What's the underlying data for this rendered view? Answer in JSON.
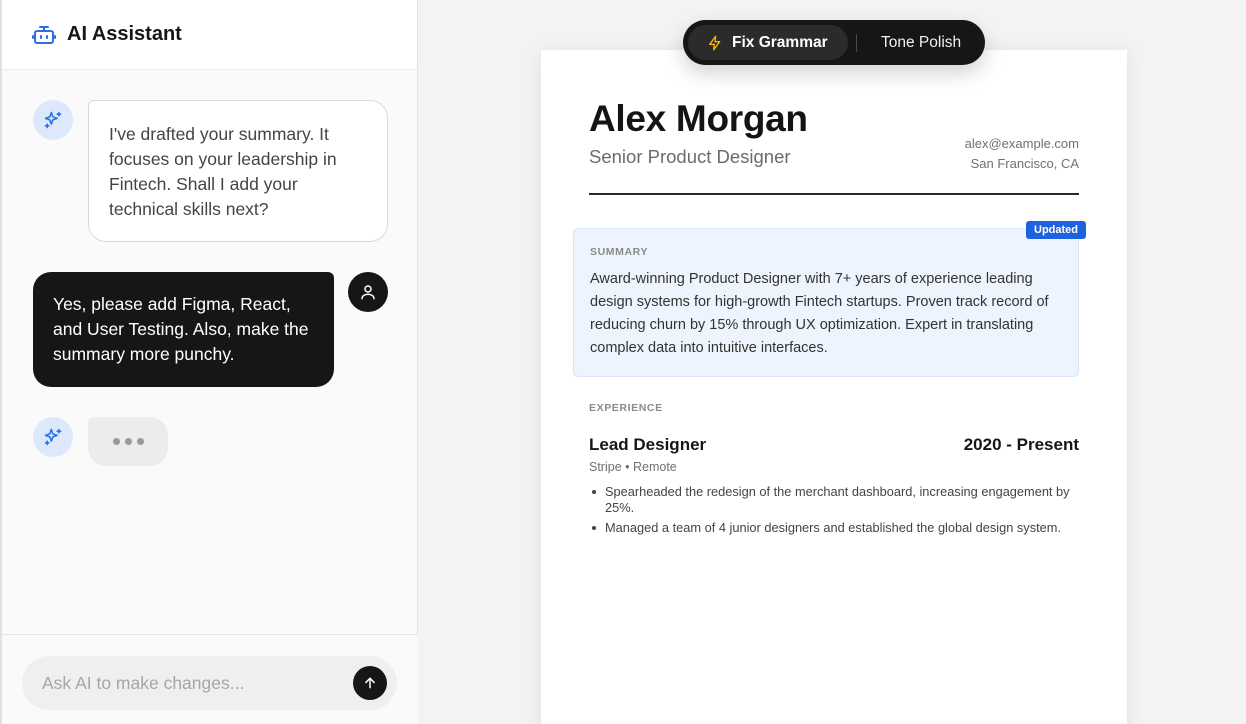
{
  "sidebar": {
    "title": "AI Assistant",
    "icons": {
      "header": "robot-icon",
      "assistant": "sparkles-icon",
      "user": "user-icon",
      "send": "arrow-up-icon"
    },
    "messages": [
      {
        "role": "assistant",
        "text": "I've drafted your summary. It focuses on your leadership in Fintech. Shall I add your technical skills next?"
      },
      {
        "role": "user",
        "text": "Yes, please add Figma, React, and User Testing. Also, make the summary more punchy."
      }
    ],
    "input_placeholder": "Ask AI to make changes..."
  },
  "toolbar": {
    "fix_label": "Fix Grammar",
    "fix_icon": "lightning-icon",
    "tone_label": "Tone Polish"
  },
  "resume": {
    "name": "Alex Morgan",
    "role": "Senior Product Designer",
    "email": "alex@example.com",
    "location": "San Francisco, CA",
    "summary": {
      "label": "SUMMARY",
      "badge": "Updated",
      "text": "Award-winning Product Designer with 7+ years of experience leading design systems for high-growth Fintech startups. Proven track record of reducing churn by 15% through UX optimization. Expert in translating complex data into intuitive interfaces."
    },
    "experience": {
      "label": "EXPERIENCE",
      "jobs": [
        {
          "title": "Lead Designer",
          "dates": "2020 - Present",
          "company": "Stripe • Remote",
          "bullets": [
            "Spearheaded the redesign of the merchant dashboard, increasing engagement by 25%.",
            "Managed a team of 4 junior designers and established the global design system."
          ]
        }
      ]
    }
  },
  "colors": {
    "accent_blue": "#1d63e0",
    "dark": "#161616",
    "summary_bg": "#edf4fd"
  }
}
